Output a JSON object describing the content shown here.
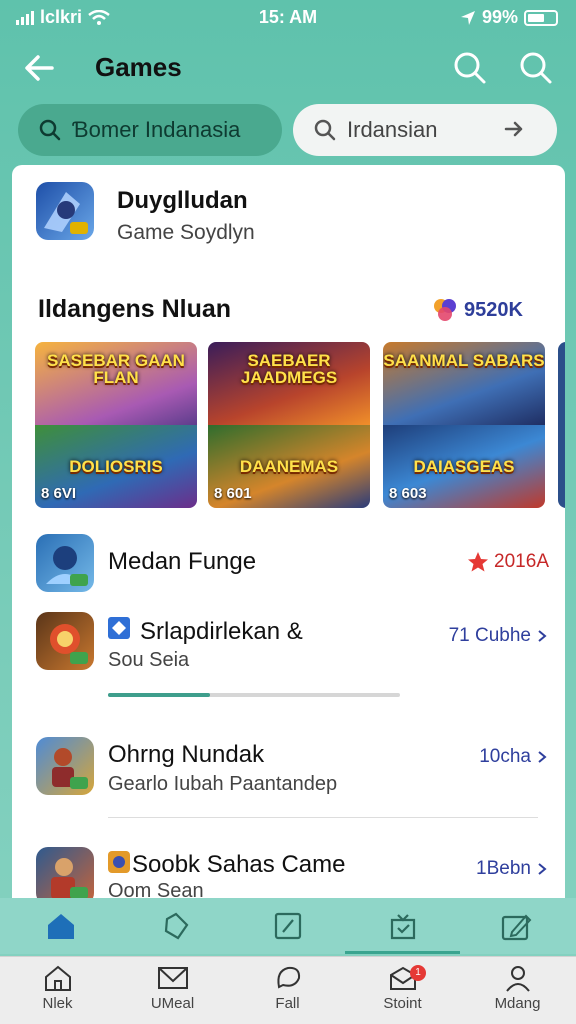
{
  "status_bar": {
    "carrier": "lclkri",
    "time": "15: AM",
    "battery": "99%"
  },
  "header": {
    "title": "Games"
  },
  "search_chips": [
    {
      "label": "Ɓomer Indanasia"
    },
    {
      "label": "Irdansian"
    }
  ],
  "featured_app": {
    "title": "Duyglludan",
    "subtitle": "Game Soydlyn"
  },
  "section": {
    "title": "Ildangens Nluan",
    "badge": "9520K",
    "banners": [
      {
        "top_caption": "SASEBAR GAAN FLAN",
        "bottom_caption": "DOLIOSRIS",
        "count": "8 6VI"
      },
      {
        "top_caption": "SAEBAER JAADMEGS",
        "bottom_caption": "DAANEMAS",
        "count": "8 601"
      },
      {
        "top_caption": "SAANMAL SABARS",
        "bottom_caption": "DAIASGEAS",
        "count": "8 603"
      }
    ]
  },
  "list": [
    {
      "title": "Medan Funge",
      "subtitle": "",
      "meta": "2016A",
      "rated": true
    },
    {
      "title": "Srlapdirlekan &",
      "subtitle": "Sou Seia",
      "meta": "71 Cubhe",
      "rated": false
    },
    {
      "title": "Ohrng Nundak",
      "subtitle": "Gearlo Iubah Paantandep",
      "meta": "10cha",
      "rated": false
    },
    {
      "title": "Soobk Sahas Came",
      "subtitle": "Oom Sean",
      "meta": "1Bebn",
      "rated": false
    }
  ],
  "download_progress": 0.35,
  "bottom_nav": [
    {
      "label": "Nlek"
    },
    {
      "label": "UMeal"
    },
    {
      "label": "Fall"
    },
    {
      "label": "Stoint",
      "badge": "1"
    },
    {
      "label": "Mdang"
    }
  ],
  "colors": {
    "accent": "#3aa590",
    "header_bg": "#5fc2ac",
    "link": "#2f3f9d",
    "star": "#e53935"
  }
}
